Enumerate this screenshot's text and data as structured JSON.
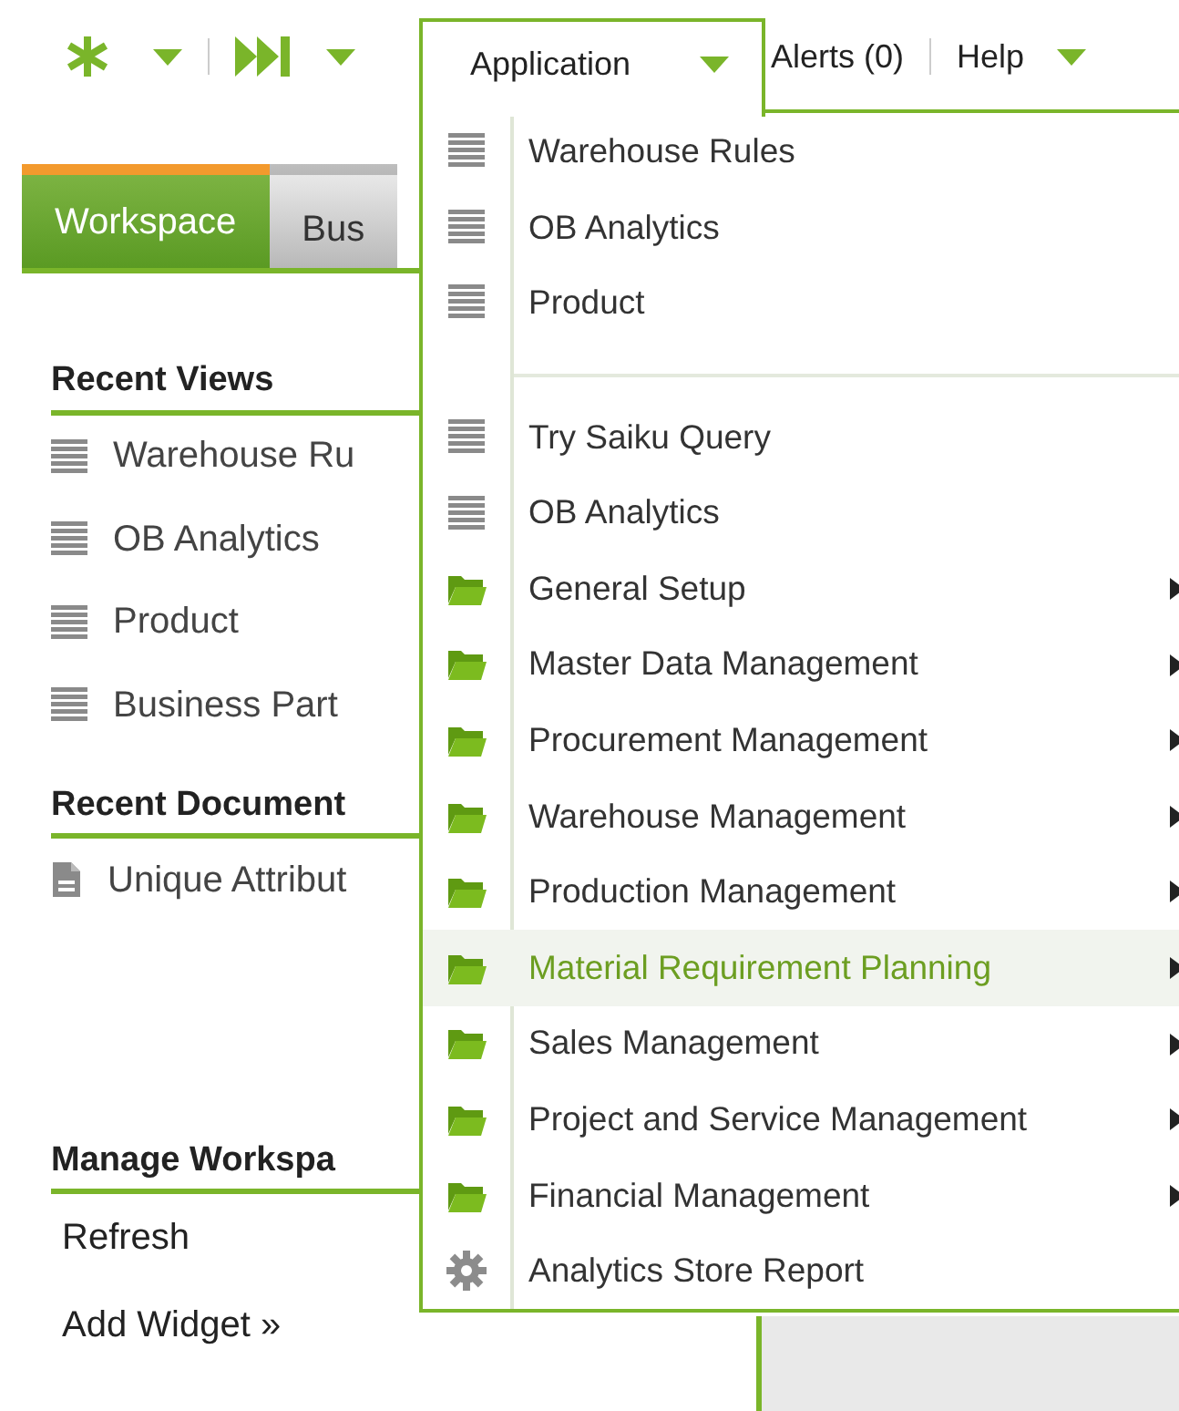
{
  "toolbar": {
    "alerts": "Alerts (0)",
    "help": "Help"
  },
  "tabs": [
    {
      "label": "Workspace",
      "selected": true
    },
    {
      "label": "Bus",
      "selected": false
    }
  ],
  "sections": [
    {
      "title": "Recent Views",
      "items": [
        {
          "label": "Warehouse Ru",
          "kind": "view"
        },
        {
          "label": "OB Analytics",
          "kind": "view"
        },
        {
          "label": "Product",
          "kind": "view"
        },
        {
          "label": "Business Part",
          "kind": "view"
        }
      ]
    },
    {
      "title": "Recent Document",
      "items": [
        {
          "label": "Unique Attribut",
          "kind": "document"
        }
      ]
    },
    {
      "title": "Manage Workspa",
      "items": [
        {
          "label": "Refresh",
          "kind": "link"
        },
        {
          "label": "Add Widget »",
          "kind": "link"
        }
      ]
    }
  ],
  "application_menu": {
    "title": "Application",
    "groups": [
      [
        {
          "label": "Warehouse Rules",
          "kind": "view",
          "selected": false,
          "has_submenu": false
        },
        {
          "label": "OB Analytics",
          "kind": "view",
          "selected": false,
          "has_submenu": false
        },
        {
          "label": "Product",
          "kind": "view",
          "selected": false,
          "has_submenu": false
        }
      ],
      [
        {
          "label": "Try Saiku Query",
          "kind": "view",
          "selected": false,
          "has_submenu": false
        },
        {
          "label": "OB Analytics",
          "kind": "view",
          "selected": false,
          "has_submenu": false
        },
        {
          "label": "General Setup",
          "kind": "folder",
          "selected": false,
          "has_submenu": true
        },
        {
          "label": "Master Data Management",
          "kind": "folder",
          "selected": false,
          "has_submenu": true
        },
        {
          "label": "Procurement Management",
          "kind": "folder",
          "selected": false,
          "has_submenu": true
        },
        {
          "label": "Warehouse Management",
          "kind": "folder",
          "selected": false,
          "has_submenu": true
        },
        {
          "label": "Production Management",
          "kind": "folder",
          "selected": false,
          "has_submenu": true
        },
        {
          "label": "Material Requirement Planning",
          "kind": "folder",
          "selected": true,
          "has_submenu": true
        },
        {
          "label": "Sales Management",
          "kind": "folder",
          "selected": false,
          "has_submenu": true
        },
        {
          "label": "Project and Service Management",
          "kind": "folder",
          "selected": false,
          "has_submenu": true
        },
        {
          "label": "Financial Management",
          "kind": "folder",
          "selected": false,
          "has_submenu": true
        },
        {
          "label": "Analytics Store Report",
          "kind": "process",
          "selected": false,
          "has_submenu": false
        }
      ]
    ]
  }
}
